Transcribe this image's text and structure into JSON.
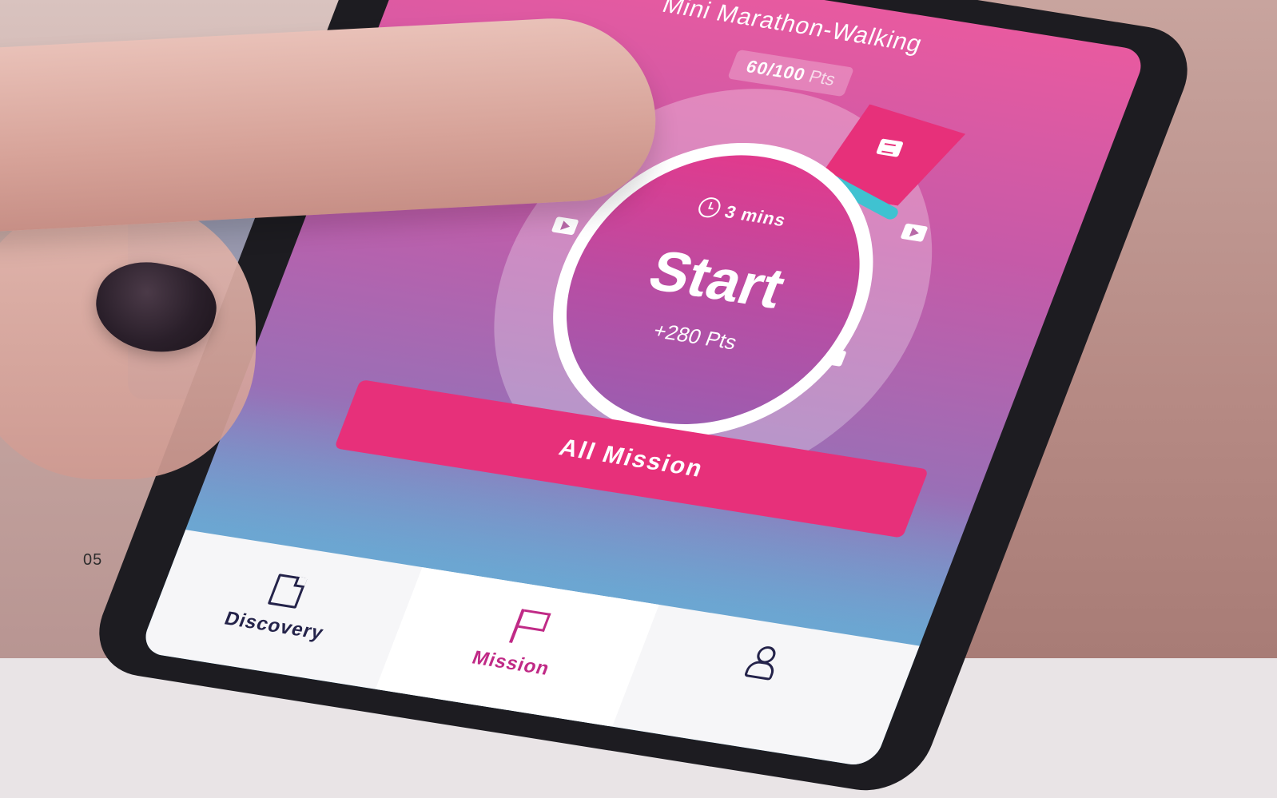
{
  "header": {
    "subtitle": "Mini Marathon-Walking",
    "points_value": "60/100",
    "points_unit": "Pts"
  },
  "timer": {
    "duration": "3 mins",
    "start_label": "Start",
    "reward": "+280 Pts"
  },
  "actions": {
    "all_mission_label": "All Mission"
  },
  "tabs": [
    {
      "label": "Discovery",
      "icon": "document-icon"
    },
    {
      "label": "Mission",
      "icon": "flag-icon",
      "active": true
    },
    {
      "label": "",
      "icon": "user-icon"
    }
  ],
  "page_number": "05",
  "colors": {
    "accent": "#e7307a",
    "teal": "#3fc2d1",
    "tab_active": "#c02a86",
    "tab_inactive": "#24234a"
  }
}
